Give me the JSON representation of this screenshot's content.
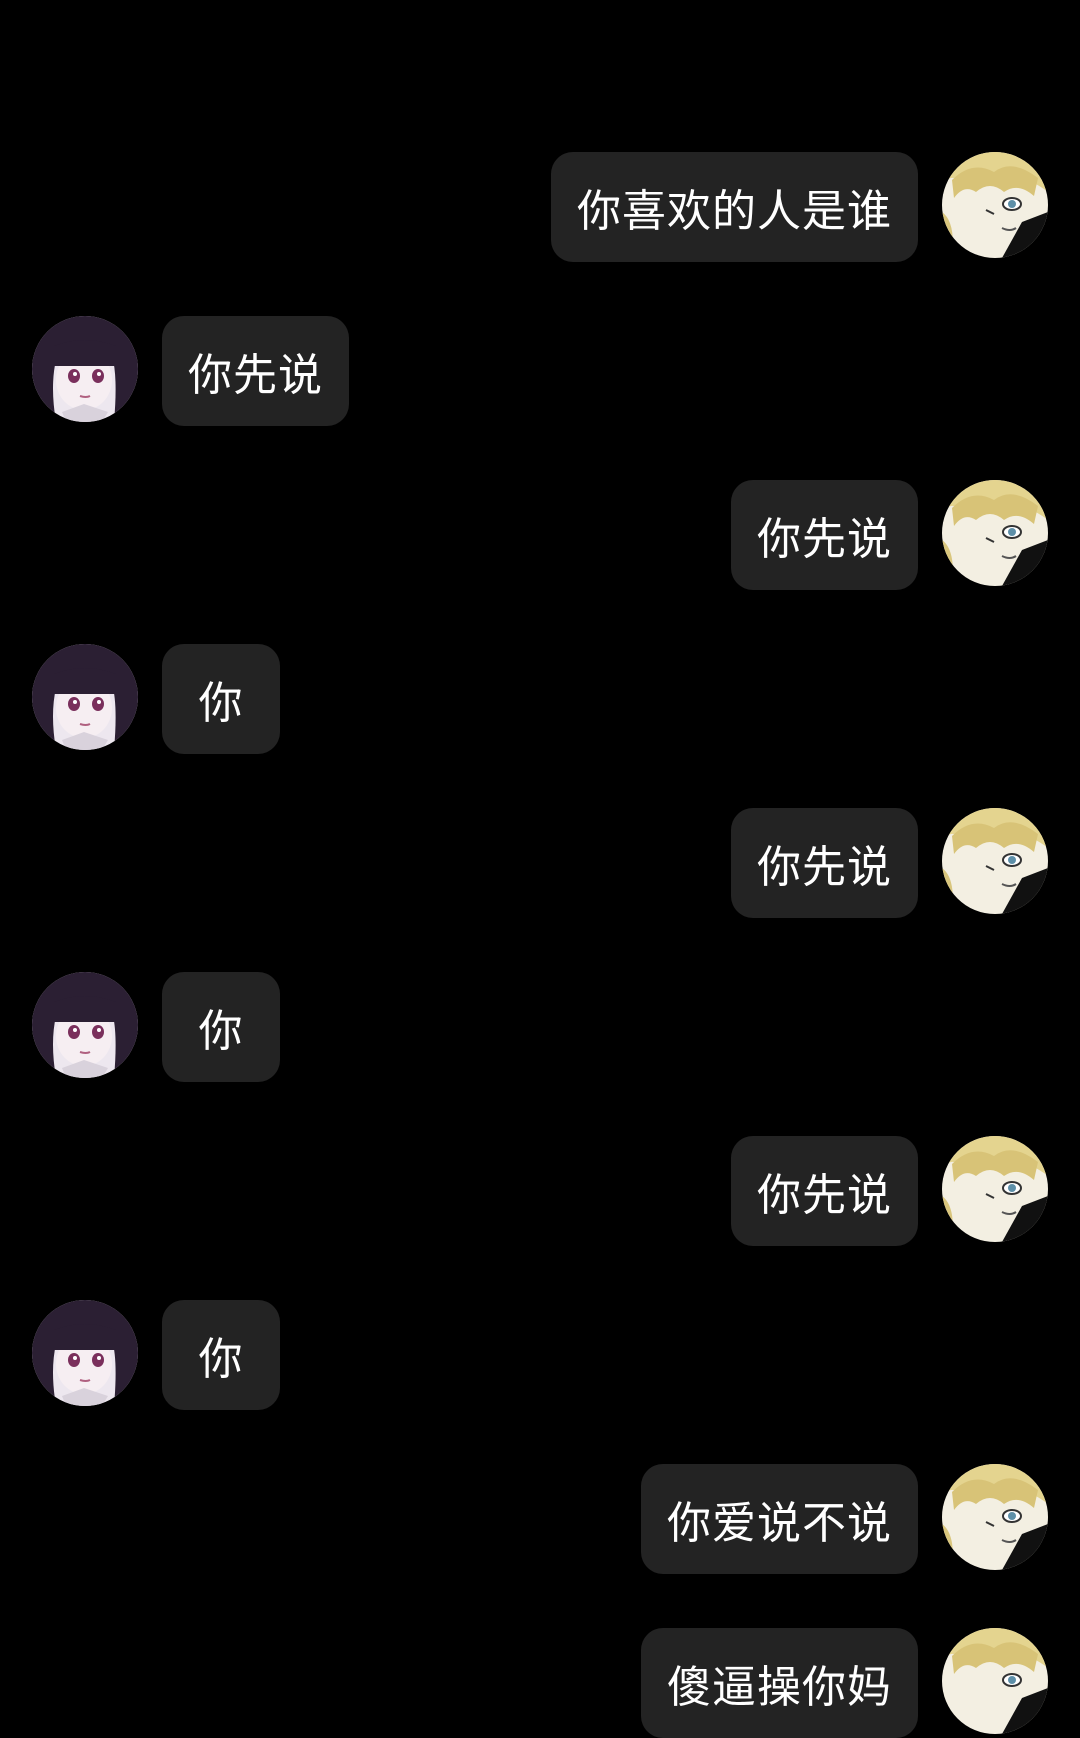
{
  "messages": [
    {
      "side": "right",
      "avatar": "blond-boy-avatar",
      "text": "你喜欢的人是谁"
    },
    {
      "side": "left",
      "avatar": "dark-hair-girl-avatar",
      "text": "你先说"
    },
    {
      "side": "right",
      "avatar": "blond-boy-avatar",
      "text": "你先说"
    },
    {
      "side": "left",
      "avatar": "dark-hair-girl-avatar",
      "text": "你"
    },
    {
      "side": "right",
      "avatar": "blond-boy-avatar",
      "text": "你先说"
    },
    {
      "side": "left",
      "avatar": "dark-hair-girl-avatar",
      "text": "你"
    },
    {
      "side": "right",
      "avatar": "blond-boy-avatar",
      "text": "你先说"
    },
    {
      "side": "left",
      "avatar": "dark-hair-girl-avatar",
      "text": "你"
    },
    {
      "side": "right",
      "avatar": "blond-boy-avatar",
      "text": "你爱说不说"
    },
    {
      "side": "right",
      "avatar": "blond-boy-avatar",
      "text": "傻逼操你妈"
    }
  ],
  "colors": {
    "background": "#000000",
    "bubble": "#232323",
    "text": "#ffffff"
  }
}
